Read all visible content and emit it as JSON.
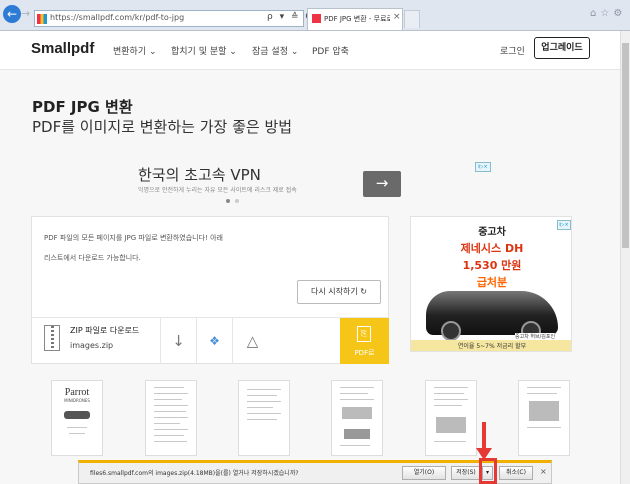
{
  "browser": {
    "url": "https://smallpdf.com/kr/pdf-to-jpg",
    "tab_title": "PDF JPG 변환 - 무료로 온...",
    "tools": "ρ ▾ ≙ C",
    "tab_close": "×",
    "right_icons": "⌂☆⚙",
    "back": "←",
    "forward": "→"
  },
  "header": {
    "logo": "Smallpdf",
    "nav": [
      "변환하기 ⌄",
      "합치기 및 분할 ⌄",
      "잠금 설정 ⌄",
      "PDF 압축"
    ],
    "login": "로그인",
    "upgrade": "업그레이드"
  },
  "hero": {
    "title": "PDF JPG 변환",
    "subtitle": "PDF를 이미지로 변환하는 가장 좋은 방법"
  },
  "vpn_ad": {
    "title": "한국의 초고속 VPN",
    "subtitle": "익명으로 안전하게 누리는 자유 모든 사이트에 리스크 제로 접속",
    "arrow": "→",
    "adchoice": "i▷×"
  },
  "result": {
    "message_line1": "PDF 파일의 모든 페이지를 JPG 파일로 변환하였습니다! 아래",
    "message_line2": "리스트에서 다운로드 가능합니다.",
    "restart_button": "다시 시작하기 ↻",
    "zip_title": "ZIP 파일로 다운로드",
    "zip_file": "images.zip",
    "download_icon": "↓",
    "dropbox_icon": "❖",
    "drive_icon": "△",
    "pdf_label": "PDF로",
    "pdf_icon": "⎘"
  },
  "car_ad": {
    "line1": "중고차",
    "line2": "제네시스 DH",
    "line3": "1,530 만원",
    "line4": "급처분",
    "footer": "연이율 5~7% 저금리 할부",
    "tag": "중고차 허브/김포인",
    "adchoice": "i▷×"
  },
  "thumbs": {
    "parrot_title": "Parrot",
    "parrot_sub": "MINIDRONES"
  },
  "download_bar": {
    "text": "files6.smallpdf.com의 images.zip(4.18MB)을(를) 열거나 저장하시겠습니까?",
    "open": "열기(O)",
    "save": "저장(S)",
    "dropdown": "▾",
    "cancel": "취소(C)",
    "close": "×"
  },
  "colors": {
    "accent_yellow": "#f5c518",
    "highlight_red": "#e53935",
    "ie_blue": "#2e7bd6"
  }
}
